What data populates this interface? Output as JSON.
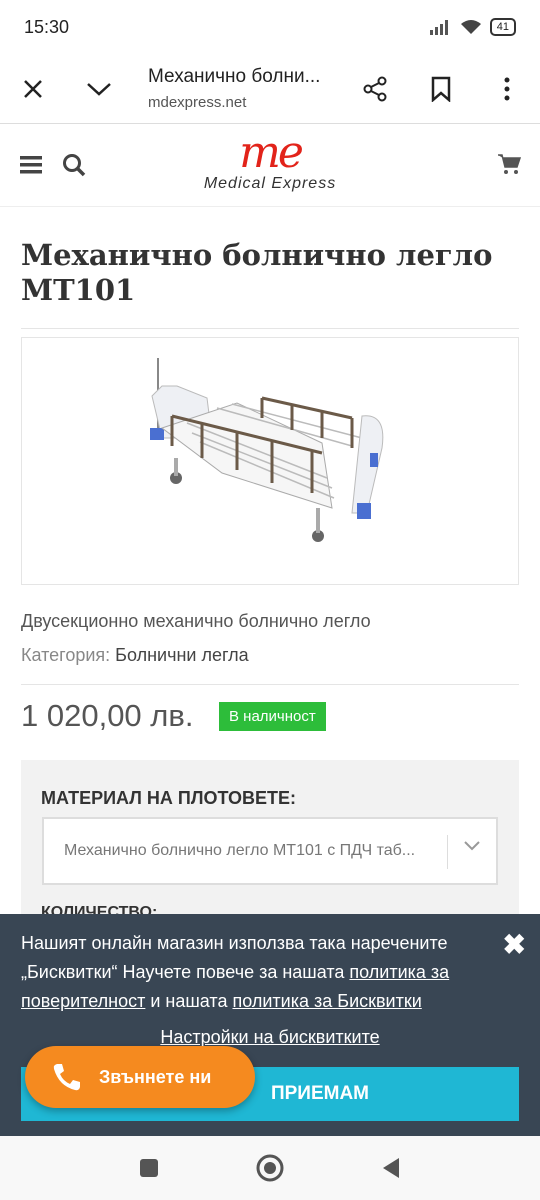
{
  "status": {
    "time": "15:30",
    "battery": "41"
  },
  "browser": {
    "title": "Механично болни...",
    "url": "mdexpress.net"
  },
  "site": {
    "logo_mark": "me",
    "logo_sub": "Medical Express"
  },
  "product": {
    "title": "Механично болнично легло МТ101",
    "description": "Двусекционно механично болнично легло",
    "category_label": "Категория:",
    "category_value": "Болнични легла",
    "price": "1 020,00 лв.",
    "stock": "В наличност"
  },
  "options": {
    "material_label": "МАТЕРИАЛ НА ПЛОТОВЕТЕ:",
    "material_value": "Механично болнично легло МТ101 с ПДЧ таб...",
    "quantity_label": "КОЛИЧЕСТВО:"
  },
  "cookie": {
    "text_1": "Нашият онлайн магазин използва така наречените „Бисквитки“ Научете повече за нашата ",
    "link_privacy": "политика за поверителност",
    "text_2": " и нашата ",
    "link_cookies": "политика за Бисквитки",
    "settings": "Настройки на бисквитките",
    "accept": "ПРИЕМАМ"
  },
  "call_button": "Звъннете ни",
  "colors": {
    "brand_red": "#e2231a",
    "in_stock": "#2dbd3a",
    "accept": "#1fb7d4",
    "call": "#f58a1f",
    "cookie_bg": "#394654"
  }
}
